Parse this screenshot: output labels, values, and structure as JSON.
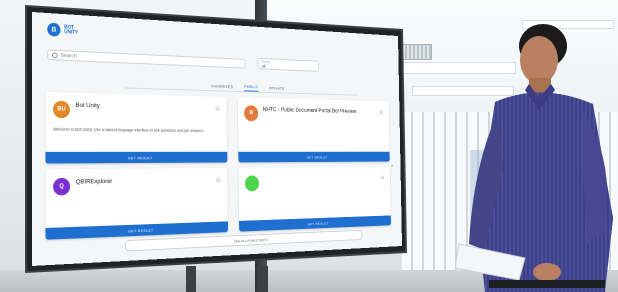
{
  "app": {
    "logo_mark": "B",
    "logo_text": "BOT UNITY"
  },
  "search": {
    "icon": "search-icon",
    "placeholder": "Search"
  },
  "filter_select": {
    "label": "Sort by",
    "value": "All"
  },
  "tabs": [
    {
      "label": "FAVORITES",
      "active": false
    },
    {
      "label": "PUBLIC",
      "active": true
    },
    {
      "label": "PRIVATE",
      "active": false
    }
  ],
  "cards": [
    {
      "icon_text": "BU",
      "icon_color": "#e0892b",
      "title": "Bot Unity",
      "subtitle": "",
      "description": "Welcome to Bot Unity! Use a natural language interface to ask questions and get answers.",
      "meta": "",
      "button": "GET RESULT"
    },
    {
      "icon_text": "B",
      "icon_color": "#e07a3c",
      "title": "NHTC - Public Document Portal Bot Preview",
      "subtitle": "",
      "description": "",
      "meta": "",
      "button": "GET RESULT"
    },
    {
      "icon_text": "Q",
      "icon_color": "#7a2fd0",
      "title": "QBIRExplorer",
      "subtitle": "",
      "description": "",
      "meta": "",
      "button": "GET RESULT"
    },
    {
      "icon_text": "",
      "icon_color": "#4cd44c",
      "title": "",
      "subtitle": "",
      "description": "",
      "meta": "",
      "button": "GET RESULT"
    }
  ],
  "see_all": "SEE ALL PUBLIC BOTS",
  "next_arrow_icon": "chevron-right-icon"
}
